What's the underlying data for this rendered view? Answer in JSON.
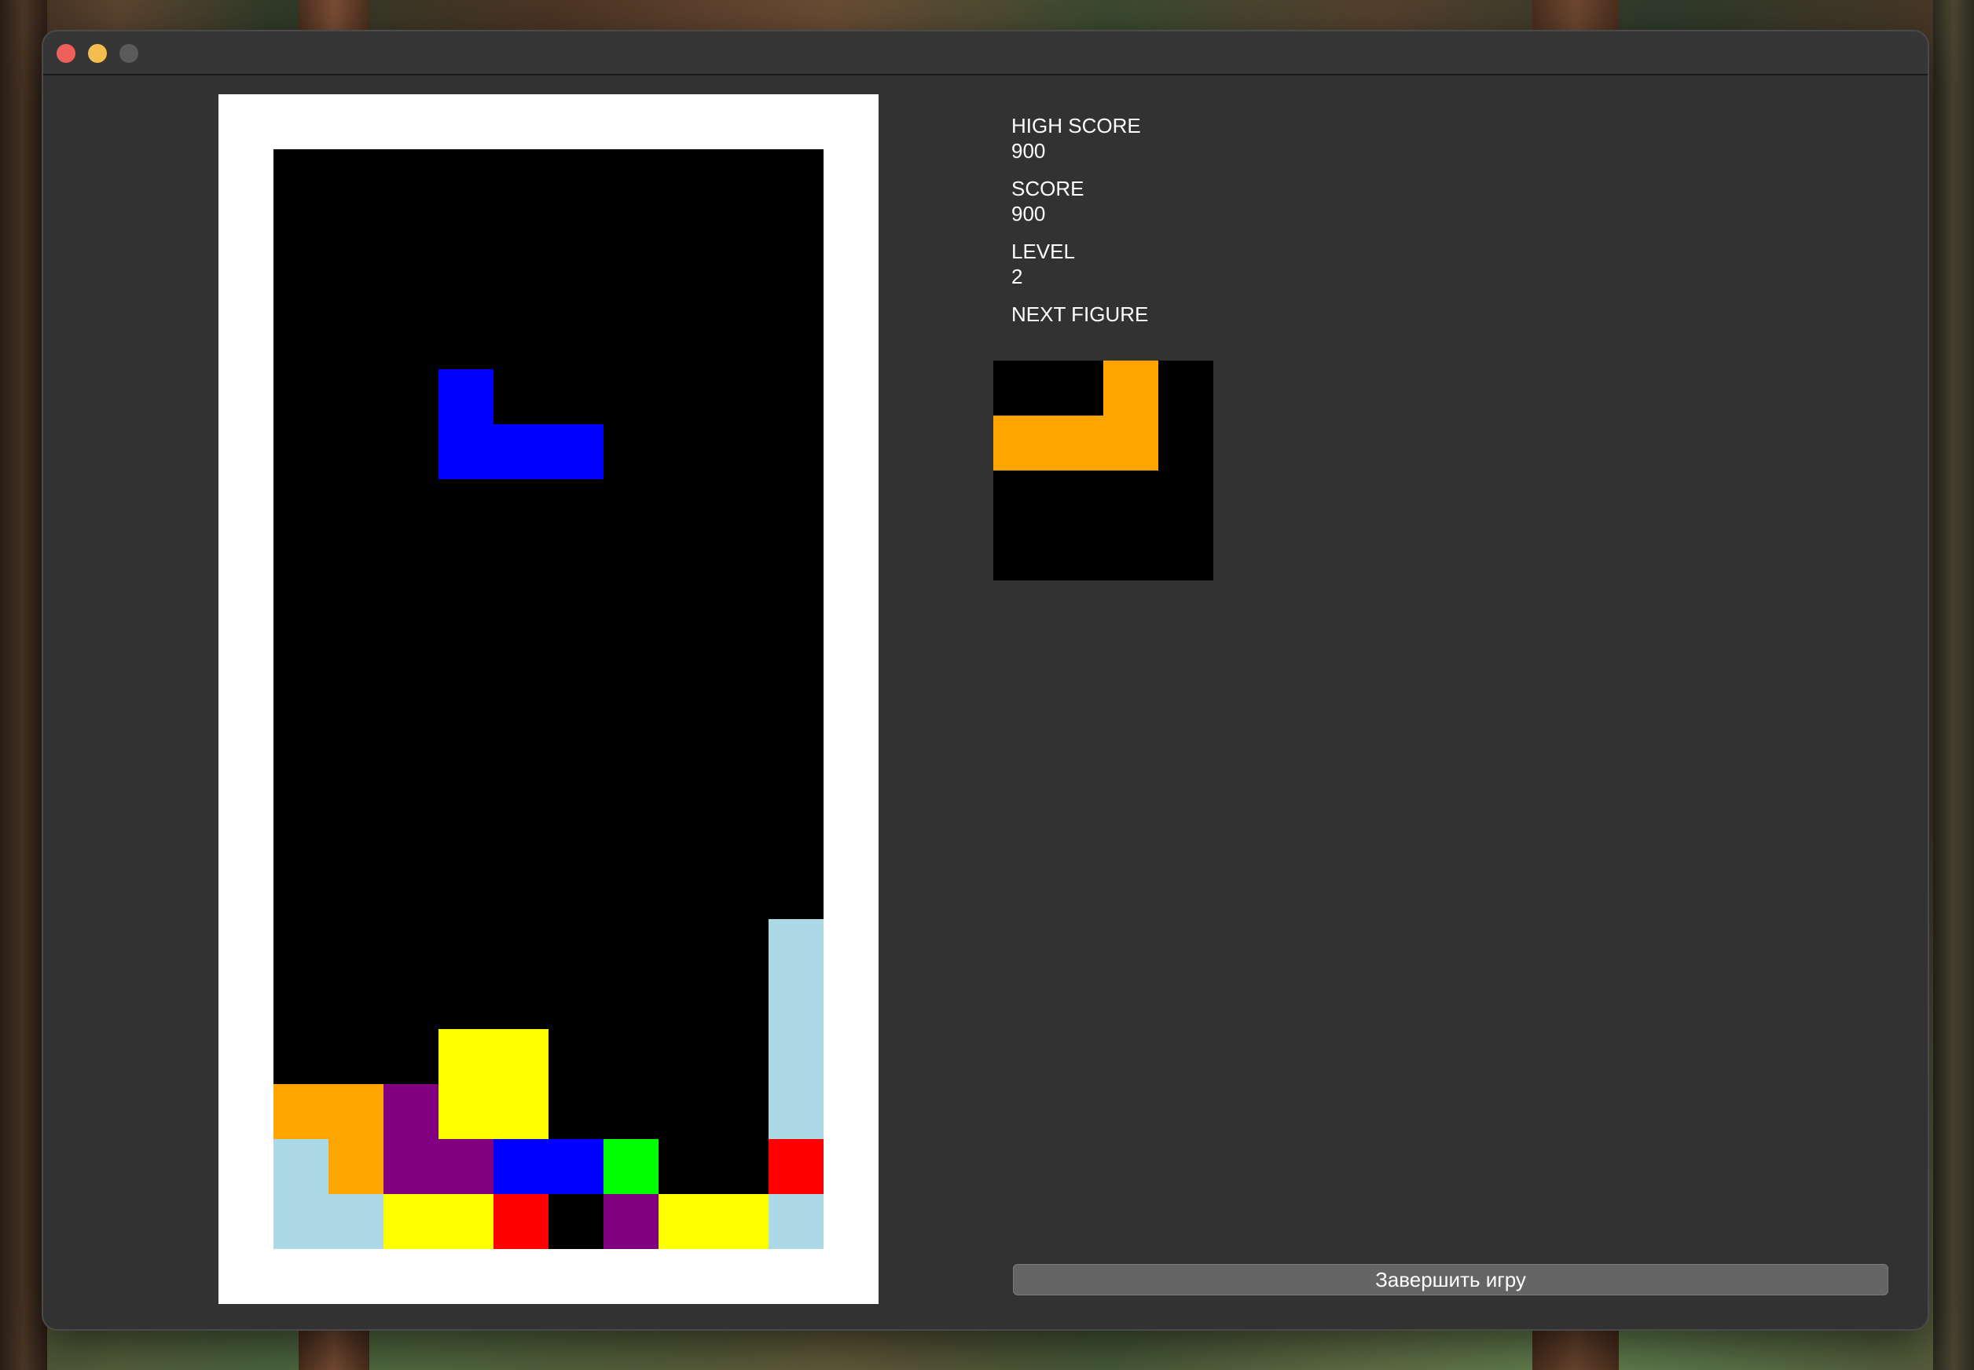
{
  "window": {
    "title": ""
  },
  "colors": {
    "blue": "#0000ff",
    "orange": "#ffa500",
    "yellow": "#ffff00",
    "purple": "#800080",
    "lightblue": "#add8e6",
    "green": "#00ff00",
    "red": "#ff0000",
    "empty": "#000000"
  },
  "board": {
    "cols": 10,
    "rows": 20,
    "active_piece": {
      "color": "blue",
      "cells": [
        [
          3,
          4
        ],
        [
          3,
          5
        ],
        [
          4,
          5
        ],
        [
          5,
          5
        ]
      ]
    },
    "locked_cells": [
      {
        "col": 9,
        "row": 14,
        "color": "lightblue"
      },
      {
        "col": 9,
        "row": 15,
        "color": "lightblue"
      },
      {
        "col": 9,
        "row": 16,
        "color": "lightblue"
      },
      {
        "col": 9,
        "row": 17,
        "color": "lightblue"
      },
      {
        "col": 3,
        "row": 16,
        "color": "yellow"
      },
      {
        "col": 4,
        "row": 16,
        "color": "yellow"
      },
      {
        "col": 0,
        "row": 17,
        "color": "orange"
      },
      {
        "col": 1,
        "row": 17,
        "color": "orange"
      },
      {
        "col": 2,
        "row": 17,
        "color": "purple"
      },
      {
        "col": 3,
        "row": 17,
        "color": "yellow"
      },
      {
        "col": 4,
        "row": 17,
        "color": "yellow"
      },
      {
        "col": 0,
        "row": 18,
        "color": "lightblue"
      },
      {
        "col": 1,
        "row": 18,
        "color": "orange"
      },
      {
        "col": 2,
        "row": 18,
        "color": "purple"
      },
      {
        "col": 3,
        "row": 18,
        "color": "purple"
      },
      {
        "col": 4,
        "row": 18,
        "color": "blue"
      },
      {
        "col": 5,
        "row": 18,
        "color": "blue"
      },
      {
        "col": 6,
        "row": 18,
        "color": "green"
      },
      {
        "col": 9,
        "row": 18,
        "color": "red"
      },
      {
        "col": 0,
        "row": 19,
        "color": "lightblue"
      },
      {
        "col": 1,
        "row": 19,
        "color": "lightblue"
      },
      {
        "col": 2,
        "row": 19,
        "color": "yellow"
      },
      {
        "col": 3,
        "row": 19,
        "color": "yellow"
      },
      {
        "col": 4,
        "row": 19,
        "color": "red"
      },
      {
        "col": 6,
        "row": 19,
        "color": "purple"
      },
      {
        "col": 7,
        "row": 19,
        "color": "yellow"
      },
      {
        "col": 8,
        "row": 19,
        "color": "yellow"
      },
      {
        "col": 9,
        "row": 19,
        "color": "lightblue"
      }
    ]
  },
  "stats": {
    "high_score_label": "HIGH SCORE",
    "high_score_value": "900",
    "score_label": "SCORE",
    "score_value": "900",
    "level_label": "LEVEL",
    "level_value": "2",
    "next_figure_label": "NEXT FIGURE"
  },
  "next_figure": {
    "cols": 4,
    "rows": 4,
    "color": "orange",
    "cells": [
      [
        2,
        0
      ],
      [
        0,
        1
      ],
      [
        1,
        1
      ],
      [
        2,
        1
      ]
    ]
  },
  "actions": {
    "end_game_label": "Завершить игру"
  }
}
